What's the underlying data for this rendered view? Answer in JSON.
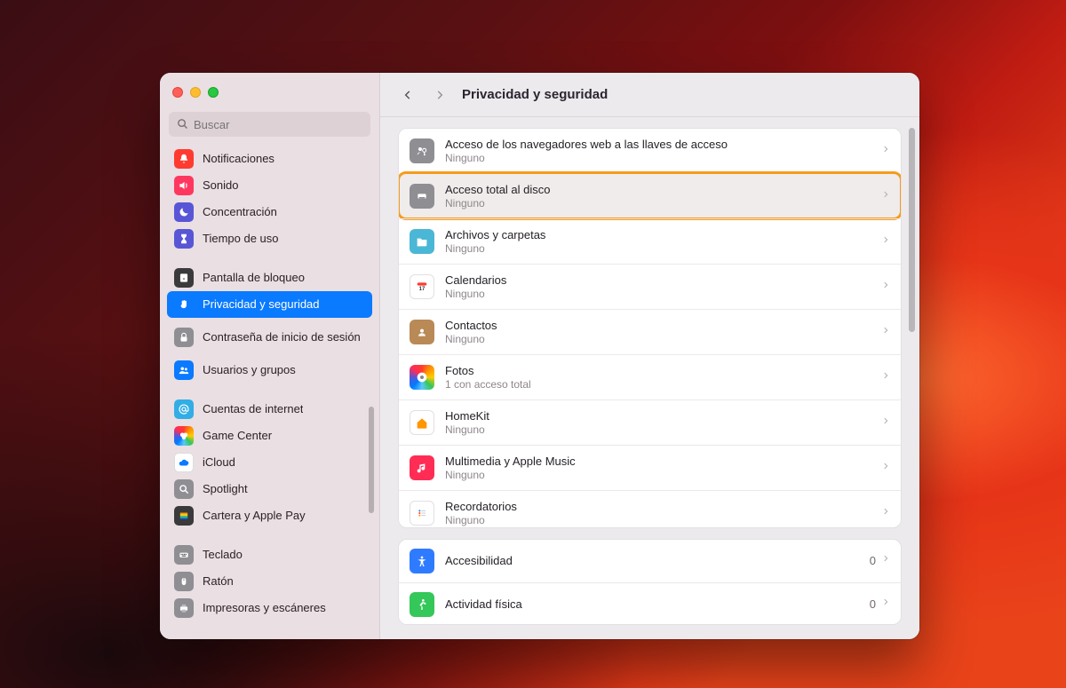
{
  "search": {
    "placeholder": "Buscar"
  },
  "header": {
    "title": "Privacidad y seguridad"
  },
  "sidebar": {
    "groups": [
      [
        {
          "label": "Notificaciones",
          "icon": "bell-icon",
          "bg": "bg-red"
        },
        {
          "label": "Sonido",
          "icon": "speaker-icon",
          "bg": "bg-pink"
        },
        {
          "label": "Concentración",
          "icon": "moon-icon",
          "bg": "bg-indigo"
        },
        {
          "label": "Tiempo de uso",
          "icon": "hourglass-icon",
          "bg": "bg-indigo"
        }
      ],
      [
        {
          "label": "Pantalla de bloqueo",
          "icon": "lock-screen-icon",
          "bg": "bg-darkgray"
        },
        {
          "label": "Privacidad y seguridad",
          "icon": "hand-icon",
          "bg": "bg-blue",
          "selected": true
        },
        {
          "label": "Contraseña de inicio de sesión",
          "icon": "lock-icon",
          "bg": "bg-gray",
          "twoLine": true
        },
        {
          "label": "Usuarios y grupos",
          "icon": "users-icon",
          "bg": "bg-blue"
        }
      ],
      [
        {
          "label": "Cuentas de internet",
          "icon": "at-icon",
          "bg": "bg-teal"
        },
        {
          "label": "Game Center",
          "icon": "gamecenter-icon",
          "bg": "bg-multi"
        },
        {
          "label": "iCloud",
          "icon": "cloud-icon",
          "bg": "bg-white"
        },
        {
          "label": "Spotlight",
          "icon": "mag-icon",
          "bg": "bg-gray"
        },
        {
          "label": "Cartera y Apple Pay",
          "icon": "wallet-icon",
          "bg": "bg-darkgray"
        }
      ],
      [
        {
          "label": "Teclado",
          "icon": "keyboard-icon",
          "bg": "bg-gray"
        },
        {
          "label": "Ratón",
          "icon": "mouse-icon",
          "bg": "bg-gray"
        },
        {
          "label": "Impresoras y escáneres",
          "icon": "printer-icon",
          "bg": "bg-gray"
        }
      ]
    ]
  },
  "main": {
    "groups": [
      [
        {
          "title": "Acceso de los navegadores web a las llaves de acceso",
          "sub": "Ninguno",
          "icon": "passkey-icon",
          "iconClass": "ic-gray"
        },
        {
          "title": "Acceso total al disco",
          "sub": "Ninguno",
          "icon": "disk-icon",
          "iconClass": "ic-gray",
          "highlight": true
        },
        {
          "title": "Archivos y carpetas",
          "sub": "Ninguno",
          "icon": "folder-icon",
          "iconClass": "ic-teal"
        },
        {
          "title": "Calendarios",
          "sub": "Ninguno",
          "icon": "calendar-icon",
          "iconClass": "ic-white"
        },
        {
          "title": "Contactos",
          "sub": "Ninguno",
          "icon": "contacts-icon",
          "iconClass": "ic-brown"
        },
        {
          "title": "Fotos",
          "sub": "1 con acceso total",
          "icon": "photos-icon",
          "iconClass": "ic-multi"
        },
        {
          "title": "HomeKit",
          "sub": "Ninguno",
          "icon": "home-icon",
          "iconClass": "ic-white"
        },
        {
          "title": "Multimedia y Apple Music",
          "sub": "Ninguno",
          "icon": "music-icon",
          "iconClass": "ic-pink"
        },
        {
          "title": "Recordatorios",
          "sub": "Ninguno",
          "icon": "reminders-icon",
          "iconClass": "ic-white"
        }
      ],
      [
        {
          "title": "Accesibilidad",
          "icon": "accessibility-icon",
          "iconClass": "ic-blue",
          "count": "0"
        },
        {
          "title": "Actividad física",
          "icon": "fitness-icon",
          "iconClass": "ic-green",
          "count": "0"
        }
      ]
    ]
  }
}
